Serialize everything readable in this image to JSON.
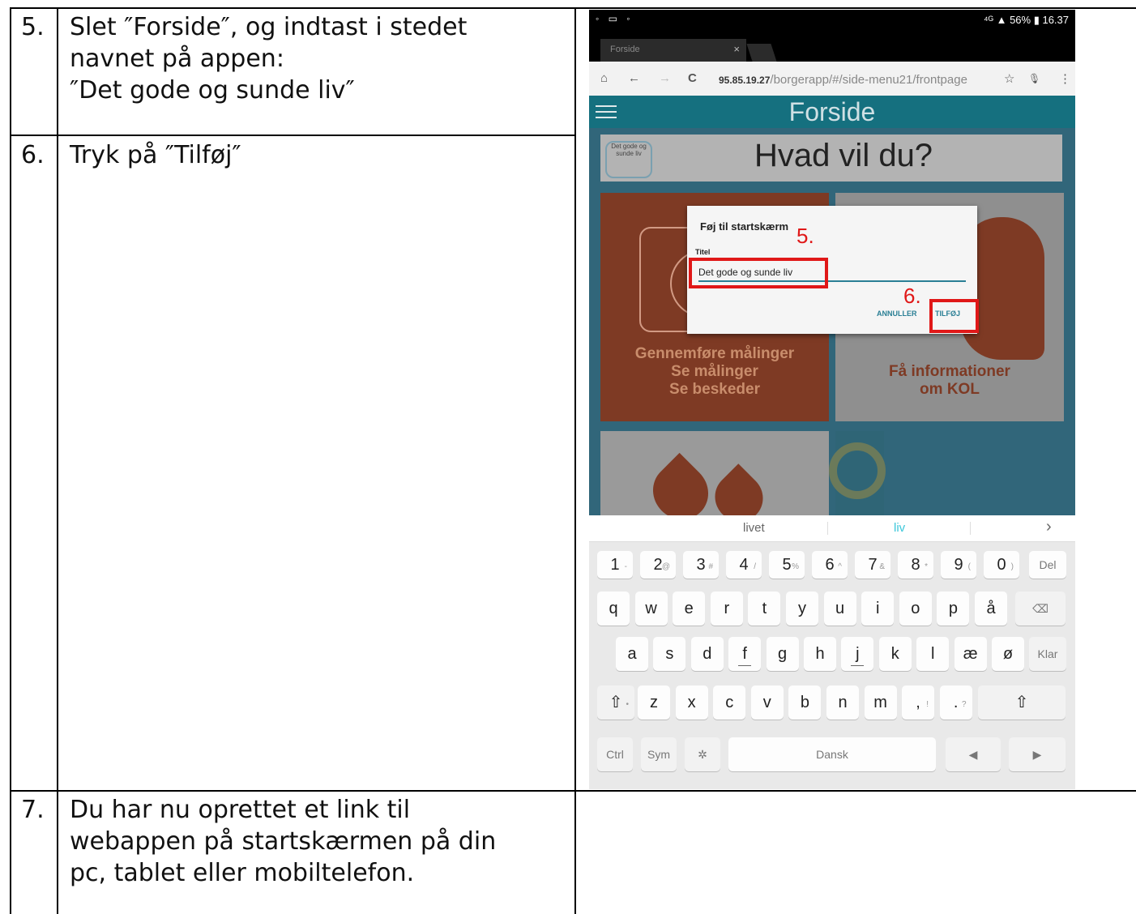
{
  "steps": [
    {
      "num": "5.",
      "text": "Slet ″Forside″, og indtast i stedet\nnavnet på appen:\n″Det gode og sunde liv″"
    },
    {
      "num": "6.",
      "text": "Tryk på ″Tilføj″"
    },
    {
      "num": "7.",
      "text": "Du har nu oprettet et link til\nwebappen på startskærmen på din\npc, tablet eller mobiltelefon."
    }
  ],
  "phone": {
    "status": {
      "left_icons": "◦ ▭ ◦",
      "right": "⁴ᴳ ▲ 56% ▮ 16.37"
    },
    "tab_title": "Forside",
    "tab_close": "×",
    "url": {
      "host": "95.85.19.27",
      "path": "/borgerapp/#/side-menu21/frontpage"
    },
    "nav": {
      "home": "⌂",
      "back": "←",
      "forward": "→",
      "reload": "C",
      "page": "🗋",
      "star": "☆",
      "mic": "🎙",
      "more": "⋮"
    },
    "app_title": "Forside",
    "hvad": "Hvad vil du?",
    "logo_text": "Det gode og sunde liv",
    "tile1_text": "Gennemføre målinger\nSe målinger\nSe beskeder",
    "tile2_text": "Få informationer\nom KOL",
    "dialog": {
      "title": "Føj til startskærm",
      "field_label": "Titel",
      "field_value": "Det gode og sunde liv",
      "cancel": "ANNULLER",
      "add": "TILFØJ"
    },
    "markers": {
      "five": "5.",
      "six": "6."
    },
    "highlight_color": "#e01818",
    "suggestions": {
      "left": "livet",
      "center": "liv",
      "arrow": "›"
    },
    "keyboard": {
      "row1": [
        [
          "1",
          "-"
        ],
        [
          "2",
          "@"
        ],
        [
          "3",
          "#"
        ],
        [
          "4",
          "/"
        ],
        [
          "5",
          "%"
        ],
        [
          "6",
          "^"
        ],
        [
          "7",
          "&"
        ],
        [
          "8",
          "*"
        ],
        [
          "9",
          "("
        ],
        [
          "0",
          ")"
        ]
      ],
      "row1_del": "Del",
      "row2": [
        "q",
        "w",
        "e",
        "r",
        "t",
        "y",
        "u",
        "i",
        "o",
        "p",
        "å"
      ],
      "backspace": "⌫",
      "row3": [
        "a",
        "s",
        "d",
        "f",
        "g",
        "h",
        "j",
        "k",
        "l",
        "æ",
        "ø"
      ],
      "enter": "Klar",
      "row4": [
        "z",
        "x",
        "c",
        "v",
        "b",
        "n",
        "m"
      ],
      "row4_punct": [
        [
          ",",
          "!"
        ],
        [
          ".",
          "?"
        ]
      ],
      "shift": "⇧",
      "ctrl": "Ctrl",
      "sym": "Sym",
      "settings": "✲",
      "space_label": "Dansk",
      "left": "◀",
      "right": "▶"
    }
  }
}
